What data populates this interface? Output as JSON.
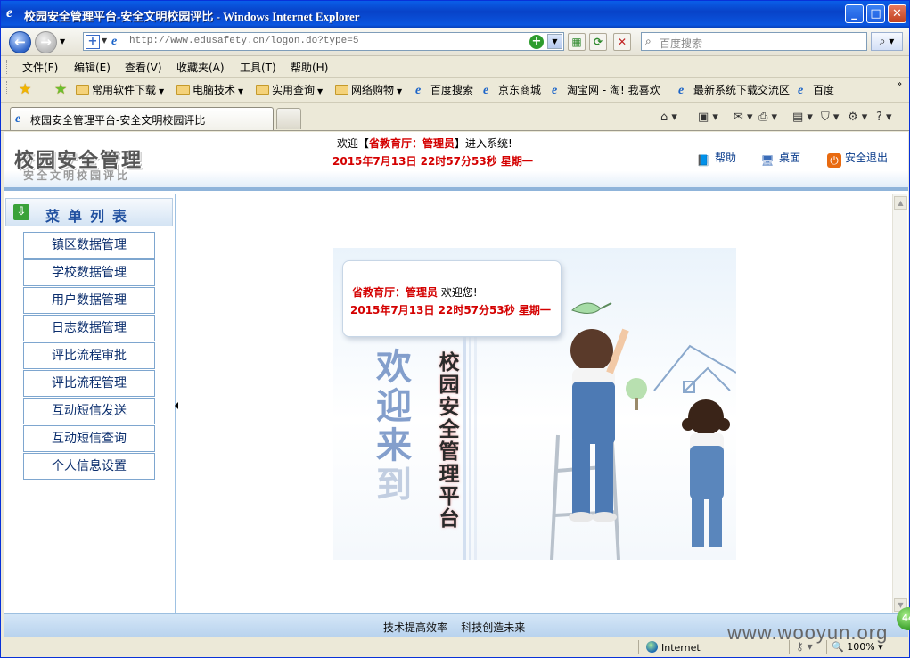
{
  "window": {
    "title": "校园安全管理平台-安全文明校园评比 - Windows Internet Explorer"
  },
  "navbar": {
    "url": "http://www.edusafety.cn/logon.do?type=5",
    "search_placeholder": "百度搜索"
  },
  "menu": [
    "文件(F)",
    "编辑(E)",
    "查看(V)",
    "收藏夹(A)",
    "工具(T)",
    "帮助(H)"
  ],
  "favorites": [
    {
      "label": "常用软件下载",
      "kind": "folder",
      "arrow": true
    },
    {
      "label": "电脑技术",
      "kind": "folder",
      "arrow": true
    },
    {
      "label": "实用查询",
      "kind": "folder",
      "arrow": true
    },
    {
      "label": "网络购物",
      "kind": "folder",
      "arrow": true
    },
    {
      "label": "百度搜索",
      "kind": "page",
      "arrow": false
    },
    {
      "label": "京东商城",
      "kind": "page",
      "arrow": false
    },
    {
      "label": "淘宝网 - 淘! 我喜欢",
      "kind": "page",
      "arrow": false
    },
    {
      "label": "最新系统下载交流区",
      "kind": "page",
      "arrow": false
    },
    {
      "label": "百度",
      "kind": "page",
      "arrow": false
    }
  ],
  "tab": {
    "title": "校园安全管理平台-安全文明校园评比"
  },
  "page": {
    "logo_main": "校园安全管理",
    "logo_sub": "安全文明校园评比",
    "welcome_prefix": "欢迎【",
    "welcome_user": "省教育厅：管理员",
    "welcome_suffix": "】进入系统!",
    "datetime": "2015年7月13日  22时57分53秒  星期一",
    "links": {
      "help": "帮助",
      "desktop": "桌面",
      "logout": "安全退出"
    }
  },
  "sidebar": {
    "heading": "菜单列表",
    "items": [
      "镇区数据管理",
      "学校数据管理",
      "用户数据管理",
      "日志数据管理",
      "评比流程审批",
      "评比流程管理",
      "互动短信发送",
      "互动短信查询",
      "个人信息设置"
    ]
  },
  "banner": {
    "user": "省教育厅：管理员",
    "greeting": " 欢迎您!",
    "datetime": "2015年7月13日  22时57分53秒  星期一",
    "big_text": [
      "欢",
      "迎",
      "来",
      "到"
    ],
    "vertical_text": [
      "校",
      "园",
      "安",
      "全",
      "管",
      "理",
      "平",
      "台"
    ]
  },
  "footer": {
    "text": "技术提高效率    科技创造未来"
  },
  "status": {
    "zone": "Internet",
    "zoom": "100%"
  },
  "watermark": "www.wooyun.org",
  "badge": "44",
  "colors": {
    "titlebar": "#0a5ee8",
    "accent_red": "#d40000",
    "footer": "#b9d3ee"
  }
}
